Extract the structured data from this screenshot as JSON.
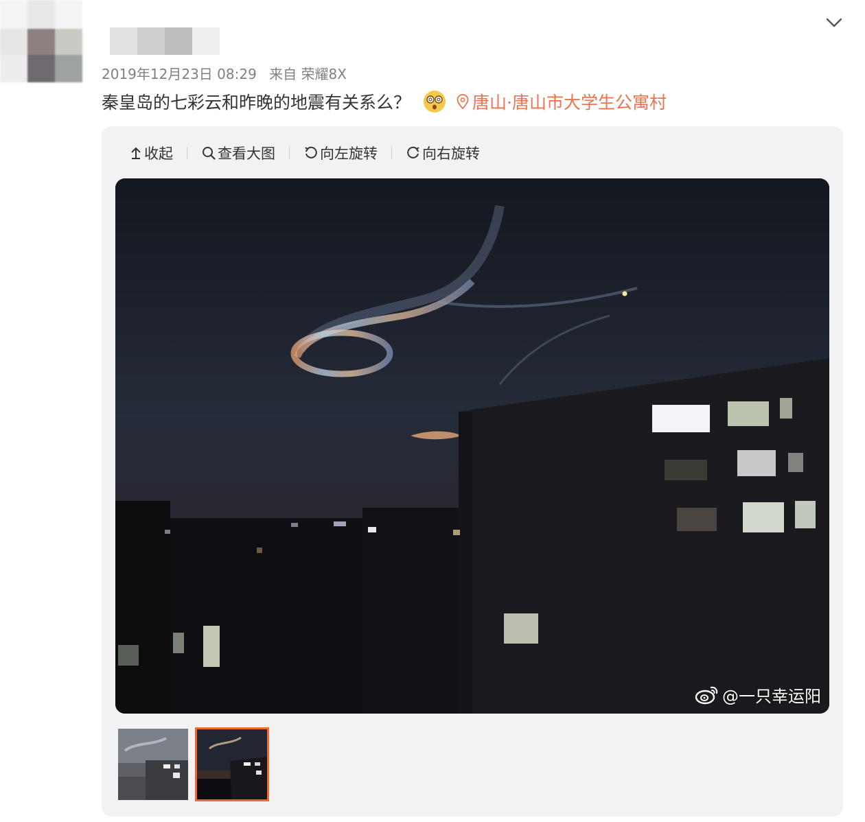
{
  "header": {
    "timestamp": "2019年12月23日 08:29",
    "source": "来自 荣耀8X"
  },
  "post": {
    "text": "秦皇岛的七彩云和昨晚的地震有关系么？",
    "emoji": "dizzy-face-emoji",
    "location": "唐山·唐山市大学生公寓村"
  },
  "toolbar": {
    "collapse": "收起",
    "view_large": "查看大图",
    "rotate_left": "向左旋转",
    "rotate_right": "向右旋转"
  },
  "image": {
    "watermark": "@一只幸运阳"
  },
  "thumbnails": [
    {
      "selected": false
    },
    {
      "selected": true
    }
  ],
  "colors": {
    "location": "#eb7350",
    "selected_border": "#f06a2a",
    "panel_bg": "#f2f2f5"
  }
}
